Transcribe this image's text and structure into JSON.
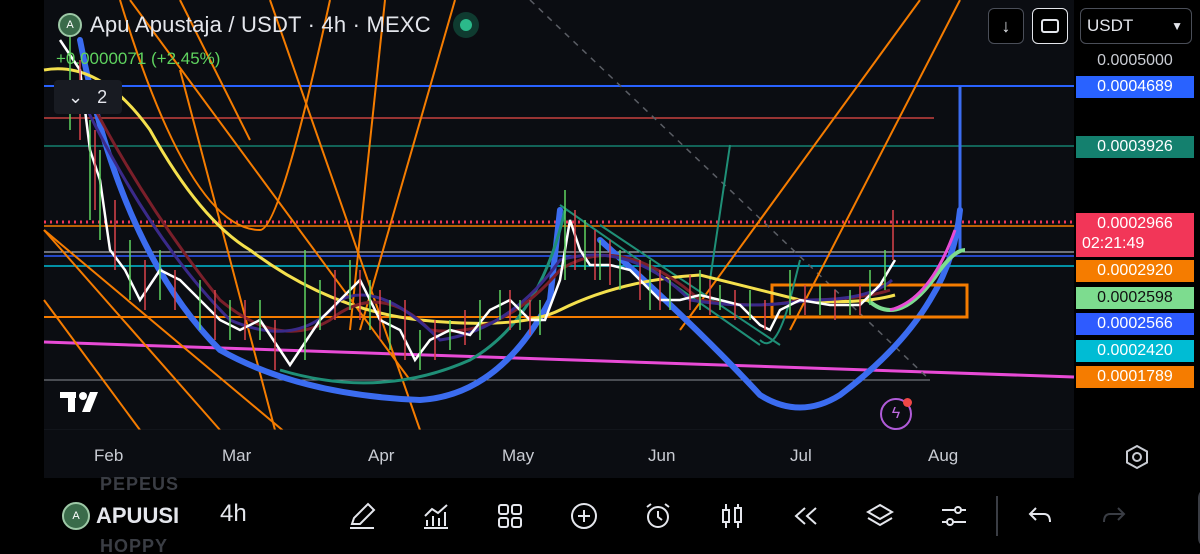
{
  "header": {
    "title": "Apu Apustaja / USDT · 4h · MEXC",
    "change": "+0.0000071 (+2.45%)",
    "indicator_count": "2"
  },
  "toolbar": {
    "currency": "USDT"
  },
  "price_scale": {
    "top_value": "0.0005000",
    "labels": [
      {
        "value": "0.0004689",
        "color": "#2962ff"
      },
      {
        "value": "0.0003926",
        "color": "#14806e"
      },
      {
        "value": "0.0002966",
        "color": "#f23658",
        "countdown": "02:21:49"
      },
      {
        "value": "0.0002920",
        "color": "#f57c00"
      },
      {
        "value": "0.0002598",
        "color": "#7ddc8f"
      },
      {
        "value": "0.0002566",
        "color": "#2e5bff"
      },
      {
        "value": "0.0002420",
        "color": "#00bcd4"
      },
      {
        "value": "0.0001789",
        "color": "#f57c00"
      }
    ]
  },
  "time_axis": [
    "Feb",
    "Mar",
    "Apr",
    "May",
    "Jun",
    "Jul",
    "Aug"
  ],
  "bottom_bar": {
    "symbol": "APUUSI",
    "timeframe": "4h",
    "ghost_top": "PEPEUS",
    "ghost_bottom": "HOPPY"
  },
  "icons": {
    "download": "download-icon",
    "fullscreen": "fullscreen-icon",
    "settings": "settings-hex-icon",
    "bolt": "lightning-icon"
  },
  "colors": {
    "background": "#0b0d12",
    "up": "#5fd35f",
    "accent_blue": "#2962ff"
  }
}
